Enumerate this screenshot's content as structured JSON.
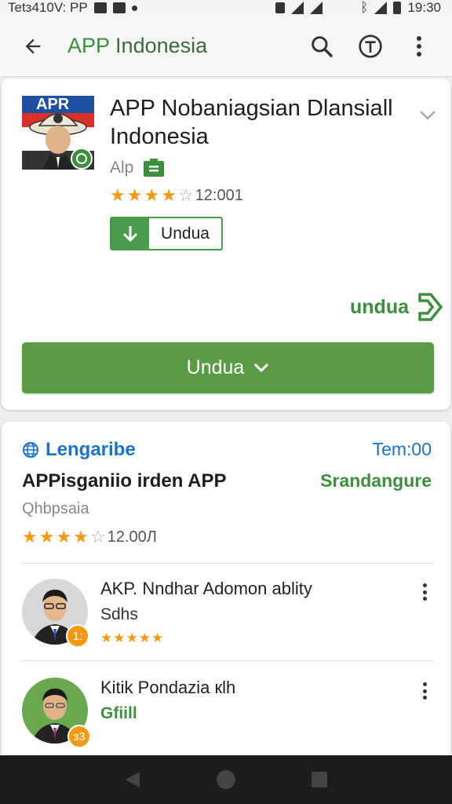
{
  "status_bar": {
    "left_text": "Tetз410V: PP",
    "time": "19:30"
  },
  "app_bar": {
    "title_accent": "APP",
    "title_rest": " Indonesia",
    "icons": [
      "back-arrow-icon",
      "search-icon",
      "filter-icon",
      "more-vert-icon"
    ]
  },
  "app_card": {
    "name": "APP Nobaniagsian Dlansiall Indonesia",
    "icon_badge_text": "APR",
    "developer": "Alp",
    "rating_stars": 4,
    "rating_count": "12:001",
    "install_small_label": "Undua",
    "undua_link": "undua",
    "install_big_label": "Undua"
  },
  "lang_card": {
    "lang_label": "Lengaribe",
    "time_label": "Tem:00",
    "title": "APPisganiio irden APP",
    "right_link": "Srandangure",
    "subtitle": "Qhbpsaia",
    "rating_stars": 4,
    "rating_count": "12.00Л",
    "reviews": [
      {
        "name": "AKP. Nndhar Adomon ablity",
        "subtitle": "Sdhs",
        "stars": "★★★★★",
        "badge": "1:"
      },
      {
        "name": "Kitik Pondazia кlh",
        "subtitle": "Gfiill",
        "badge": "з3"
      }
    ]
  },
  "colors": {
    "green": "#5a9b45",
    "accent_green": "#3d8f3d",
    "blue": "#1a73c8",
    "star": "#f39a12"
  }
}
